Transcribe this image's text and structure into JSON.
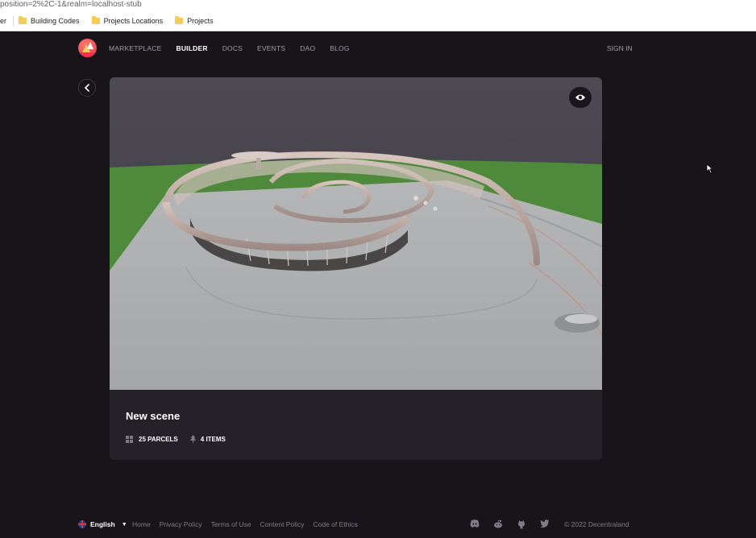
{
  "browser": {
    "url_fragment": "position=2%2C-1&realm=localhost-stub",
    "bookmark_edge": "er",
    "bookmarks": [
      "Building Codes",
      "Projects Locations",
      "Projects"
    ]
  },
  "nav": {
    "links": [
      "MARKETPLACE",
      "BUILDER",
      "DOCS",
      "EVENTS",
      "DAO",
      "BLOG"
    ],
    "active": "BUILDER",
    "sign_in": "SIGN IN"
  },
  "card": {
    "title": "New scene",
    "parcels": "25 PARCELS",
    "items": "4 ITEMS"
  },
  "footer": {
    "language": "English",
    "links": [
      "Home",
      "Privacy Policy",
      "Terms of Use",
      "Content Policy",
      "Code of Ethics"
    ],
    "social_icons": [
      "discord-icon",
      "reddit-icon",
      "github-icon",
      "twitter-icon"
    ],
    "copyright": "© 2022 Decentraland"
  },
  "colors": {
    "background": "#18141a",
    "card": "#242129",
    "ground_green": "#4f8a3c",
    "platform": "#a9abae",
    "accent": "#ff2d55"
  }
}
